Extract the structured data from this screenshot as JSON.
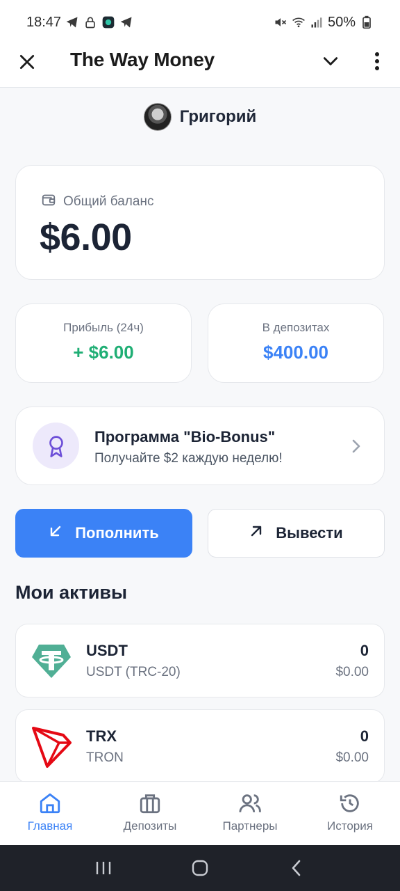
{
  "status_bar": {
    "time": "18:47",
    "battery": "50%",
    "icons": [
      "telegram-icon",
      "lock-icon",
      "app-icon",
      "telegram-icon",
      "mute-icon",
      "wifi-icon",
      "signal-icon",
      "battery-icon"
    ]
  },
  "app_bar": {
    "title": "The Way Money",
    "icons": [
      "close-icon",
      "chevron-down-icon",
      "more-vertical-icon"
    ]
  },
  "user": {
    "name": "Григорий"
  },
  "balance": {
    "label": "Общий баланс",
    "amount": "$6.00",
    "icon": "wallet-icon"
  },
  "stats": {
    "profit_label": "Прибыль (24ч)",
    "profit_value": "+ $6.00",
    "deposits_label": "В депозитах",
    "deposits_value": "$400.00"
  },
  "promo": {
    "title": "Программа \"Bio-Bonus\"",
    "subtitle": "Получайте $2 каждую неделю!",
    "icon": "award-icon"
  },
  "actions": {
    "deposit_label": "Пополнить",
    "withdraw_label": "Вывести"
  },
  "assets": {
    "title": "Мои активы",
    "items": [
      {
        "symbol": "USDT",
        "name": "USDT (TRC-20)",
        "amount": "0",
        "usd": "$0.00",
        "icon": "tether-icon"
      },
      {
        "symbol": "TRX",
        "name": "TRON",
        "amount": "0",
        "usd": "$0.00",
        "icon": "tron-icon"
      }
    ]
  },
  "tabs": [
    {
      "label": "Главная",
      "icon": "home-icon",
      "active": true
    },
    {
      "label": "Депозиты",
      "icon": "briefcase-icon",
      "active": false
    },
    {
      "label": "Партнеры",
      "icon": "users-icon",
      "active": false
    },
    {
      "label": "История",
      "icon": "history-icon",
      "active": false
    }
  ],
  "colors": {
    "accent": "#3b82f6",
    "profit": "#1fae74",
    "tether": "#50af95",
    "tron": "#e50914",
    "promo_badge": "#ede9fb"
  }
}
